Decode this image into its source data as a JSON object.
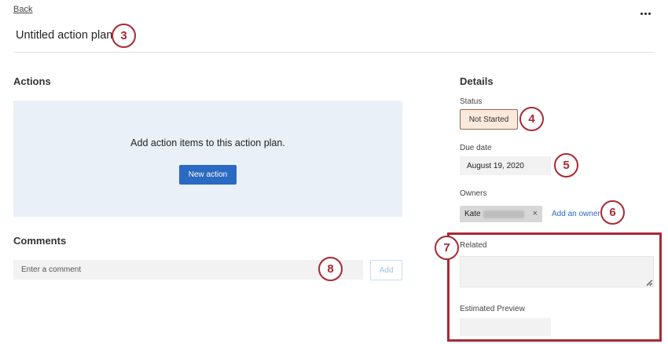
{
  "header": {
    "back_label": "Back",
    "title": "Untitled action plan",
    "more_icon": "more-horizontal-icon"
  },
  "actions": {
    "heading": "Actions",
    "empty_message": "Add action items to this action plan.",
    "new_action_label": "New action"
  },
  "comments": {
    "heading": "Comments",
    "input_placeholder": "Enter a comment",
    "add_label": "Add"
  },
  "details": {
    "heading": "Details",
    "status_label": "Status",
    "status_value": "Not Started",
    "due_label": "Due date",
    "due_value": "August 19, 2020",
    "owners_label": "Owners",
    "owner_name": "Kate",
    "owner_remove": "×",
    "add_owner_label": "Add an owner",
    "related_label": "Related",
    "preview_label": "Estimated Preview"
  },
  "callouts": {
    "c3": "3",
    "c4": "4",
    "c5": "5",
    "c6": "6",
    "c7": "7",
    "c8": "8"
  },
  "colors": {
    "accent": "#2a6ac2",
    "callout": "#a72a36",
    "actions_bg": "#eaf0f8",
    "status_bg": "#fbe9dc"
  }
}
